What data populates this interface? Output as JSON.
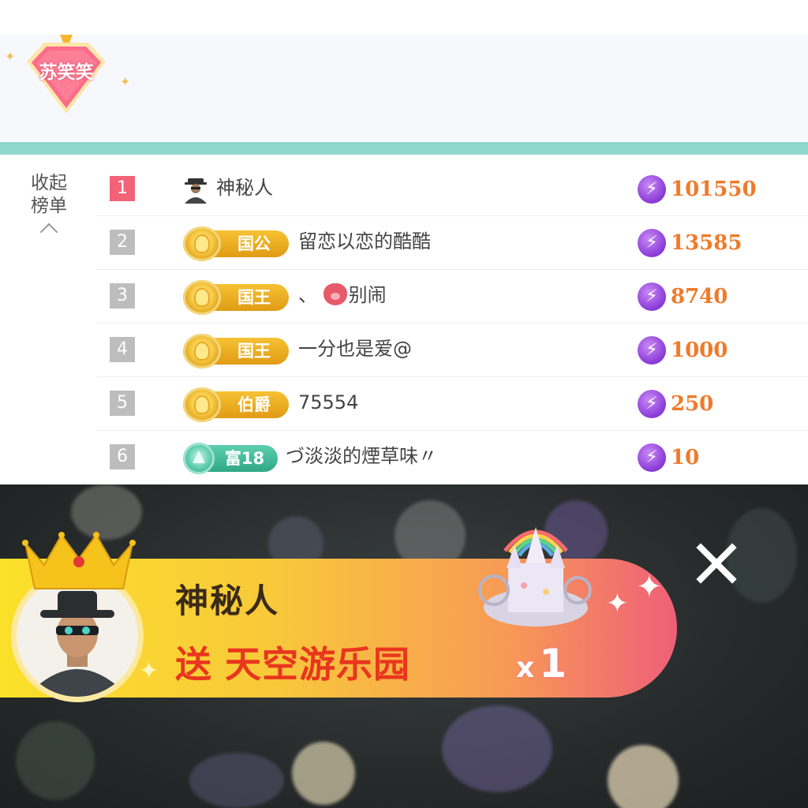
{
  "header": {
    "anchor_name": "苏笑笑"
  },
  "leaderboard": {
    "collapse_line1": "收起",
    "collapse_line2": "榜单",
    "rows": [
      {
        "rank": "1",
        "title": "",
        "name": "神秘人",
        "score": "101550"
      },
      {
        "rank": "2",
        "title": "国公",
        "name": "留恋以恋的酷酷",
        "score": "13585"
      },
      {
        "rank": "3",
        "title": "国王",
        "name_prefix": "、",
        "name": "别闹",
        "score": "8740"
      },
      {
        "rank": "4",
        "title": "国王",
        "name": "一分也是爱@",
        "score": "1000"
      },
      {
        "rank": "5",
        "title": "伯爵",
        "name": "75554",
        "score": "250"
      },
      {
        "rank": "6",
        "title": "富18",
        "name": "づ淡淡的煙草味〃",
        "score": "10"
      }
    ]
  },
  "gift_banner": {
    "sender": "神秘人",
    "action": "送",
    "gift_name": "天空游乐园",
    "qty_prefix": "x",
    "qty": "1"
  },
  "icons": {
    "rank_score_icon": "lightning-bolt-icon",
    "close": "close-icon"
  },
  "colors": {
    "accent_teal": "#8fd6cc",
    "rank_first": "#f26378",
    "score_orange": "#f07a2a",
    "bolt_purple": "#8e3fd9"
  }
}
